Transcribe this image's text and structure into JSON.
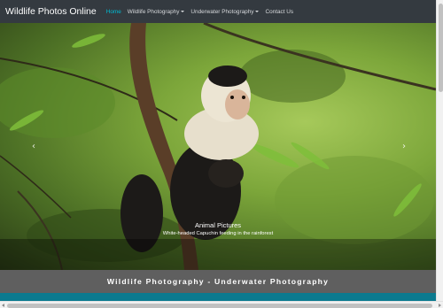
{
  "navbar": {
    "brand": "Wildlife Photos Online",
    "links": [
      {
        "label": "Home",
        "active": true
      },
      {
        "label": "Wildlife Photography",
        "dropdown": true
      },
      {
        "label": "Underwater Photography",
        "dropdown": true
      },
      {
        "label": "Contact Us"
      }
    ]
  },
  "carousel": {
    "prev_icon": "chevron-left-icon",
    "next_icon": "chevron-right-icon",
    "caption_title": "Animal Pictures",
    "caption_text": "White-headed Capuchin feeding in the rainforest"
  },
  "tagline": "Wildlife Photography - Underwater Photography",
  "colors": {
    "navbar_bg": "#343a40",
    "active_link": "#00bcd4",
    "tagline_bg": "#5f5f5f",
    "accent_strip": "#0b7a8f"
  }
}
